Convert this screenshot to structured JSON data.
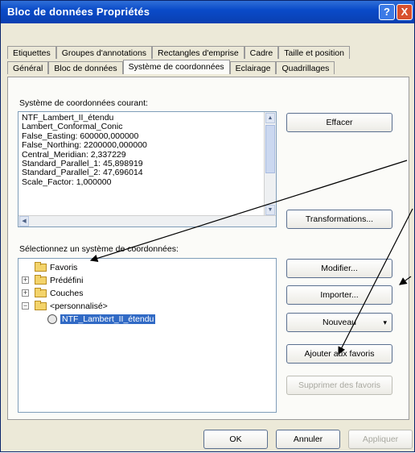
{
  "window": {
    "title": "Bloc de données Propriétés",
    "help_glyph": "?",
    "close_glyph": "X"
  },
  "tabs_row1": [
    "Etiquettes",
    "Groupes d'annotations",
    "Rectangles d'emprise",
    "Cadre",
    "Taille et position"
  ],
  "tabs_row2": [
    "Général",
    "Bloc de données",
    "Système de coordonnées",
    "Eclairage",
    "Quadrillages"
  ],
  "active_tab": "Système de coordonnées",
  "current_cs": {
    "label": "Système de coordonnées courant:",
    "lines": [
      "NTF_Lambert_II_étendu",
      "Lambert_Conformal_Conic",
      "False_Easting: 600000,000000",
      "False_Northing: 2200000,000000",
      "Central_Meridian: 2,337229",
      "Standard_Parallel_1: 45,898919",
      "Standard_Parallel_2: 47,696014",
      "Scale_Factor: 1,000000"
    ],
    "clear_button": "Effacer",
    "transformations_button": "Transformations..."
  },
  "select_cs": {
    "label": "Sélectionnez un système de coordonnées:",
    "tree": {
      "favoris": "Favoris",
      "predefini": "Prédéfini",
      "couches": "Couches",
      "personnalise": "<personnalisé>",
      "selected_item": "NTF_Lambert_II_étendu"
    },
    "expander_plus": "+",
    "expander_minus": "−",
    "buttons": {
      "modifier": "Modifier...",
      "importer": "Importer...",
      "nouveau": "Nouveau",
      "nouveau_arrow": "▾",
      "ajouter": "Ajouter aux favoris",
      "supprimer": "Supprimer des favoris"
    }
  },
  "footer": {
    "ok": "OK",
    "annuler": "Annuler",
    "appliquer": "Appliquer"
  },
  "scroll_glyphs": {
    "up": "▲",
    "down": "▼",
    "left": "◀"
  },
  "colors": {
    "titlebar": "#0a4bc9",
    "selection": "#316ac5",
    "annotation_arrows": "#000000"
  }
}
